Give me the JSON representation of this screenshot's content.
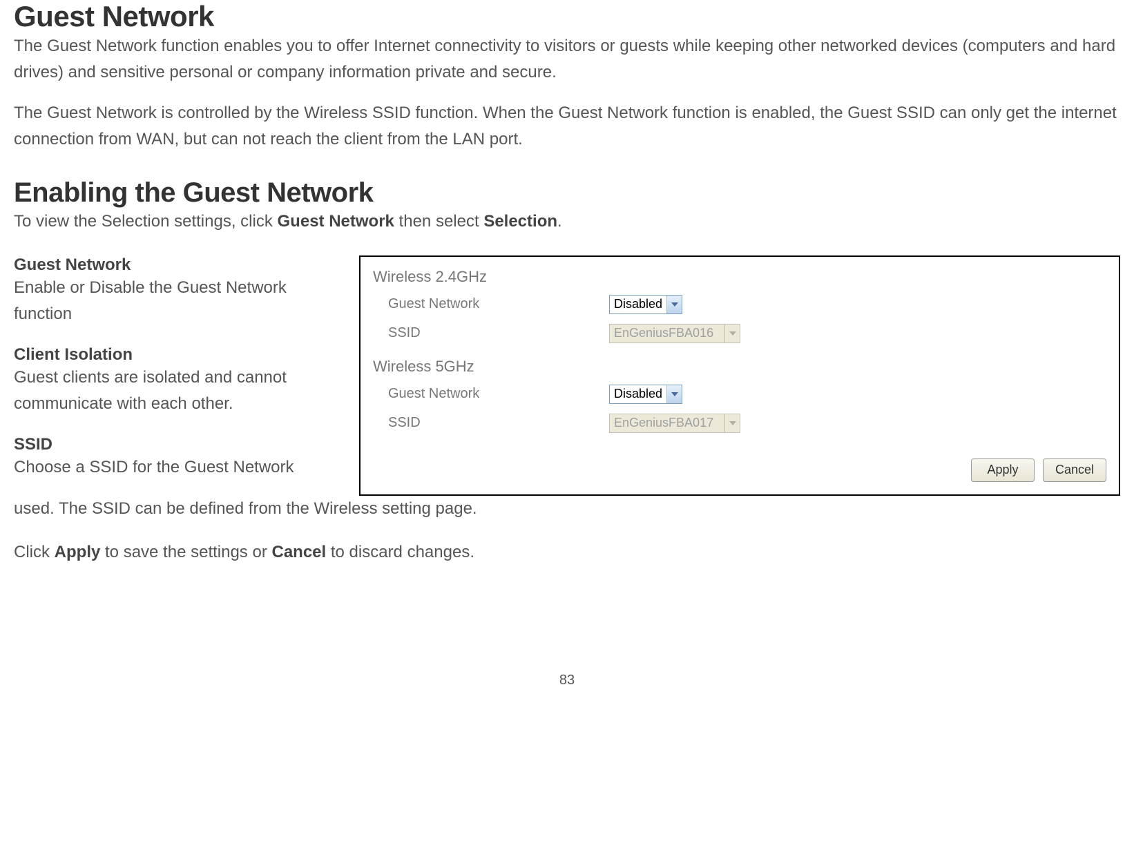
{
  "heading1": "Guest Network",
  "intro_p1": "The Guest Network function enables you to offer Internet connectivity to visitors or guests while keeping other networked devices (computers and hard drives) and sensitive personal or company information private and secure.",
  "intro_p2": "The Guest Network is controlled by the Wireless SSID function. When the Guest Network function is enabled, the Guest SSID can only get the internet connection from WAN, but can not reach the client from the LAN port.",
  "heading2": "Enabling the Guest Network",
  "instruction_parts": {
    "a": "To view the Selection settings, click ",
    "b": "Guest Network",
    "c": " then select ",
    "d": "Selection",
    "e": "."
  },
  "definitions": {
    "guest_network": {
      "title": "Guest Network",
      "body": "Enable or Disable the Guest Network function"
    },
    "client_isolation": {
      "title": "Client Isolation",
      "body": "Guest clients are isolated and cannot communicate with each other."
    },
    "ssid": {
      "title": "SSID",
      "body_line1": "Choose a SSID for the Guest Network",
      "body_line2": "used. The SSID can be defined from the Wireless setting page."
    }
  },
  "panel": {
    "group24": {
      "heading": "Wireless 2.4GHz",
      "guest_label": "Guest Network",
      "guest_value": "Disabled",
      "ssid_label": "SSID",
      "ssid_value": "EnGeniusFBA016"
    },
    "group5": {
      "heading": "Wireless 5GHz",
      "guest_label": "Guest Network",
      "guest_value": "Disabled",
      "ssid_label": "SSID",
      "ssid_value": "EnGeniusFBA017"
    },
    "apply_label": "Apply",
    "cancel_label": "Cancel"
  },
  "closing_parts": {
    "a": "Click ",
    "b": "Apply",
    "c": " to save the settings or ",
    "d": "Cancel",
    "e": " to discard changes."
  },
  "page_number": "83"
}
